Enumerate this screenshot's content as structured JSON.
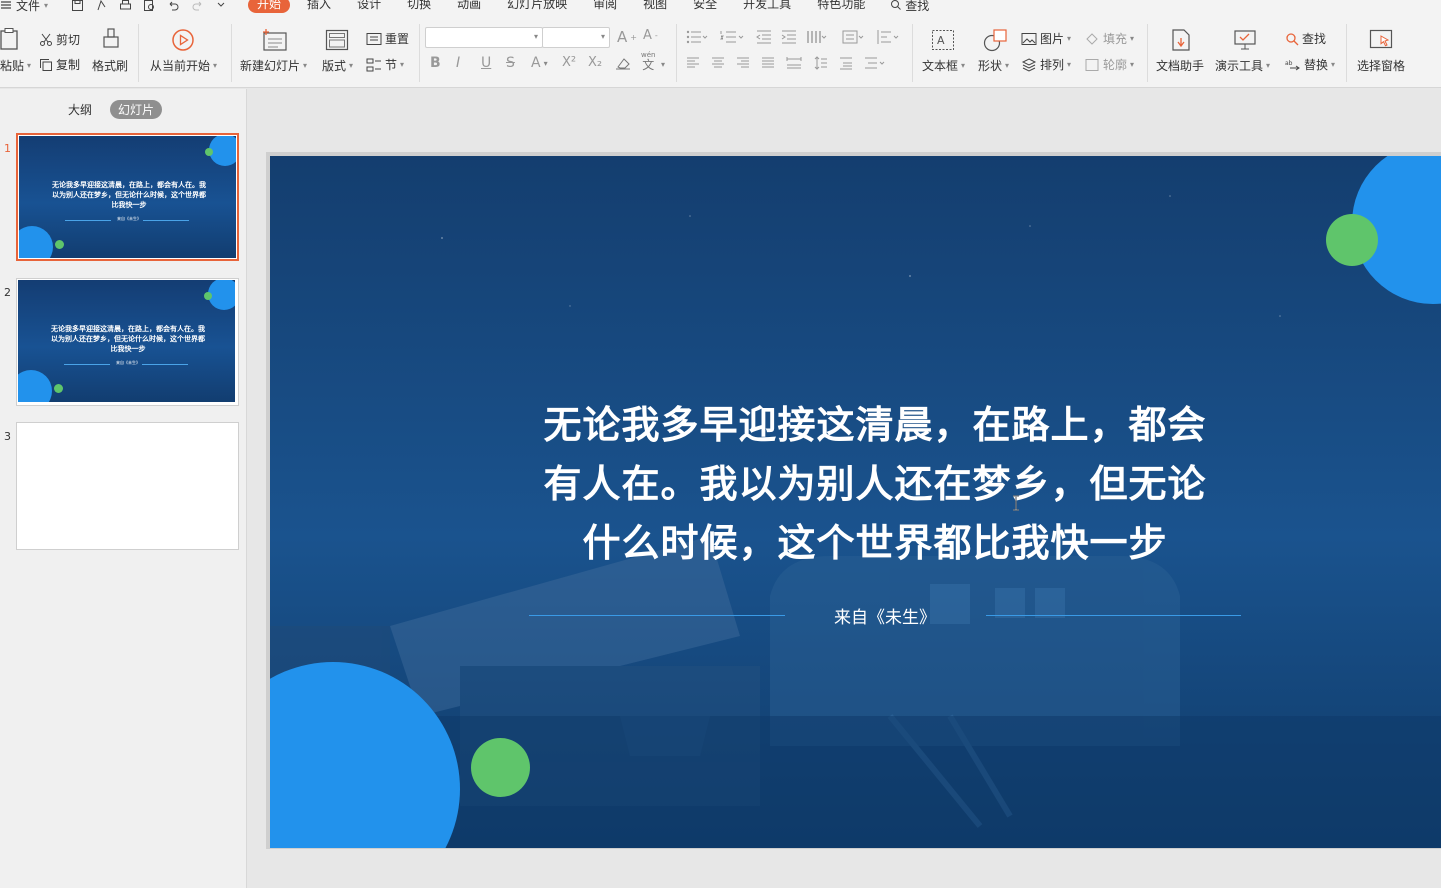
{
  "menu": {
    "file": "文件",
    "tabs": [
      "开始",
      "插入",
      "设计",
      "切换",
      "动画",
      "幻灯片放映",
      "审阅",
      "视图",
      "安全",
      "开发工具",
      "特色功能"
    ],
    "active_tab": "开始",
    "search": "查找"
  },
  "ribbon": {
    "paste": "粘贴",
    "cut": "剪切",
    "copy": "复制",
    "format_painter": "格式刷",
    "from_current": "从当前开始",
    "new_slide": "新建幻灯片",
    "layout": "版式",
    "reset": "重置",
    "section": "节",
    "text_box": "文本框",
    "shape": "形状",
    "picture": "图片",
    "fill": "填充",
    "arrange": "排列",
    "outline": "轮廓",
    "doc_assistant": "文档助手",
    "present_tools": "演示工具",
    "find": "查找",
    "replace": "替换",
    "select_pane": "选择窗格",
    "font_name": "",
    "font_size": "",
    "pinyin_top": "wén",
    "pinyin_char": "文"
  },
  "left_pane": {
    "tabs": [
      "大纲",
      "幻灯片"
    ],
    "active_tab": "幻灯片",
    "slides": [
      {
        "num": "1",
        "text": "无论我多早迎接这清晨，在路上，都会有人在。我以为别人还在梦乡，但无论什么时候，这个世界都比我快一步",
        "sub": "来自《未生》"
      },
      {
        "num": "2",
        "text": "无论我多早迎接这清晨，在路上，都会有人在。我以为别人还在梦乡，但无论什么时候，这个世界都比我快一步",
        "sub": "来自《未生》"
      },
      {
        "num": "3",
        "text": "",
        "sub": ""
      }
    ]
  },
  "slide": {
    "quote_lines": [
      "无论我多早迎接这清晨，在路上，都会",
      "有人在。我以为别人还在梦乡，但无论",
      "什么时候，这个世界都比我快一步"
    ],
    "source": "来自《未生》"
  },
  "colors": {
    "accent": "#e8643a",
    "slide_bg": "#17508c",
    "blue_circle": "#2292ec",
    "green_circle": "#5fc56b",
    "line": "#3a9ae6"
  }
}
